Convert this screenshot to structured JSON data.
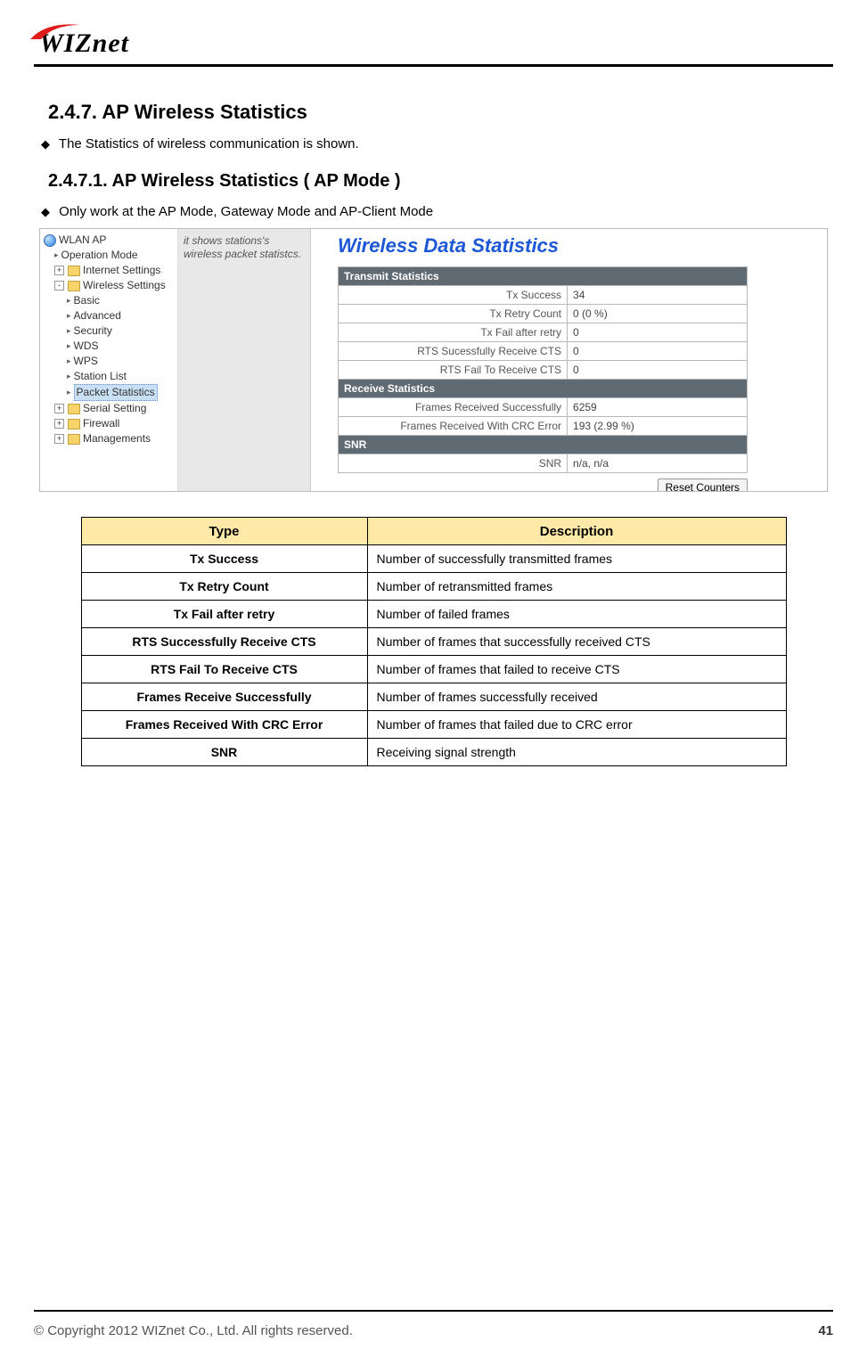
{
  "header": {
    "logo_text": "WIZnet"
  },
  "section": {
    "num_title": "2.4.7.  AP  Wireless  Statistics",
    "intro": "The Statistics of wireless communication is shown.",
    "sub_num_title": "2.4.7.1. AP Wireless Statistics ( AP Mode )",
    "sub_intro": "Only work at the AP Mode, Gateway Mode and AP-Client Mode"
  },
  "screenshot": {
    "tree": {
      "root": "WLAN AP",
      "l1_op": "Operation Mode",
      "l1_net": "Internet Settings",
      "l1_ws": "Wireless Settings",
      "ws_basic": "Basic",
      "ws_adv": "Advanced",
      "ws_sec": "Security",
      "ws_wds": "WDS",
      "ws_wps": "WPS",
      "ws_sl": "Station List",
      "ws_ps": "Packet Statistics",
      "l1_serial": "Serial Setting",
      "l1_fw": "Firewall",
      "l1_mg": "Managements",
      "pm_plus": "+",
      "pm_minus": "-"
    },
    "hint": "it shows stations's wireless packet statistcs.",
    "title": "Wireless Data Statistics",
    "sections": {
      "tx": "Transmit Statistics",
      "rx": "Receive Statistics",
      "snr": "SNR"
    },
    "rows": {
      "tx_success_l": "Tx Success",
      "tx_success_v": "34",
      "tx_retry_l": "Tx Retry Count",
      "tx_retry_v": "0 (0 %)",
      "tx_fail_l": "Tx Fail after retry",
      "tx_fail_v": "0",
      "rts_ok_l": "RTS Sucessfully Receive CTS",
      "rts_ok_v": "0",
      "rts_fail_l": "RTS Fail To Receive CTS",
      "rts_fail_v": "0",
      "rx_ok_l": "Frames Received Successfully",
      "rx_ok_v": "6259",
      "rx_crc_l": "Frames Received With CRC Error",
      "rx_crc_v": "193 (2.99 %)",
      "snr_l": "SNR",
      "snr_v": "n/a, n/a"
    },
    "reset_btn": "Reset Counters"
  },
  "desc_table": {
    "h_type": "Type",
    "h_desc": "Description",
    "rows": [
      {
        "t": "Tx Success",
        "d": "Number of successfully transmitted frames"
      },
      {
        "t": "Tx Retry Count",
        "d": "Number of retransmitted frames"
      },
      {
        "t": "Tx Fail after retry",
        "d": "Number of failed frames"
      },
      {
        "t": "RTS Successfully Receive CTS",
        "d": "Number of frames that successfully received CTS"
      },
      {
        "t": "RTS Fail To Receive CTS",
        "d": "Number of frames that failed to receive CTS"
      },
      {
        "t": "Frames Receive Successfully",
        "d": "Number of frames successfully received"
      },
      {
        "t": "Frames Received With CRC Error",
        "d": "Number of frames that failed due to CRC error"
      },
      {
        "t": "SNR",
        "d": "Receiving signal strength"
      }
    ]
  },
  "footer": {
    "copyright": "© Copyright 2012 WIZnet Co., Ltd. All rights reserved.",
    "page": "41"
  }
}
